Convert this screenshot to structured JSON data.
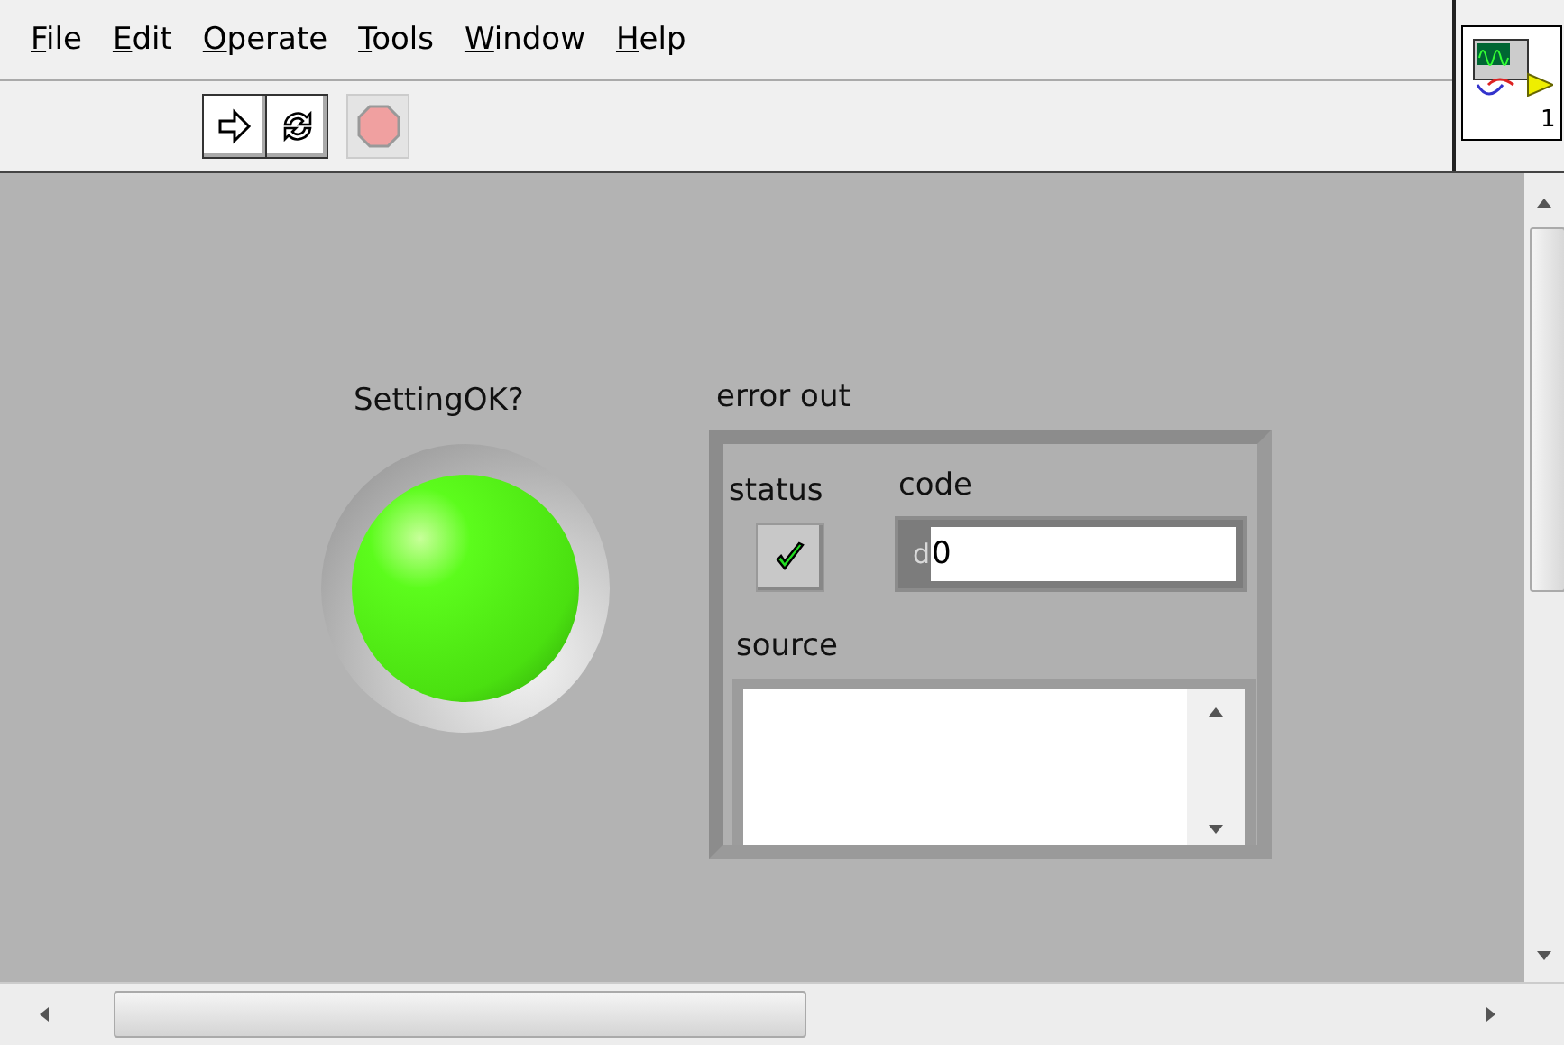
{
  "menu": [
    {
      "label": "File"
    },
    {
      "label": "Edit"
    },
    {
      "label": "Operate"
    },
    {
      "label": "Tools"
    },
    {
      "label": "Window"
    },
    {
      "label": "Help"
    }
  ],
  "toolbar": {
    "running": false
  },
  "vi_icon": {
    "text": "1"
  },
  "led": {
    "label": "SettingOK?",
    "on": true
  },
  "error_out": {
    "label": "error out",
    "status": {
      "label": "status",
      "error": false
    },
    "code": {
      "label": "code",
      "radix": "d",
      "value": "0"
    },
    "source": {
      "label": "source"
    }
  }
}
